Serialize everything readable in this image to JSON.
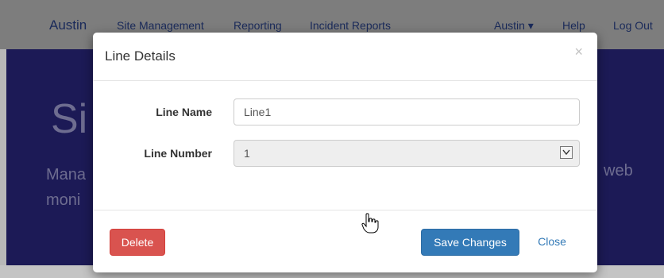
{
  "navbar": {
    "brand": "Austin",
    "links": [
      "Site Management",
      "Reporting",
      "Incident Reports"
    ],
    "user": "Austin ▾",
    "help": "Help",
    "logout": "Log Out"
  },
  "hero": {
    "title": "Si",
    "subtitle": "Mana\nmoni",
    "right": "web"
  },
  "modal": {
    "title": "Line Details",
    "close_icon": "×",
    "fields": {
      "line_name_label": "Line Name",
      "line_name_value": "Line1",
      "line_number_label": "Line Number",
      "line_number_value": "1"
    },
    "buttons": {
      "delete": "Delete",
      "save": "Save Changes",
      "close": "Close"
    }
  },
  "colors": {
    "primary": "#337ab7",
    "danger": "#d9534f",
    "hero_bg": "#1c1a56"
  }
}
